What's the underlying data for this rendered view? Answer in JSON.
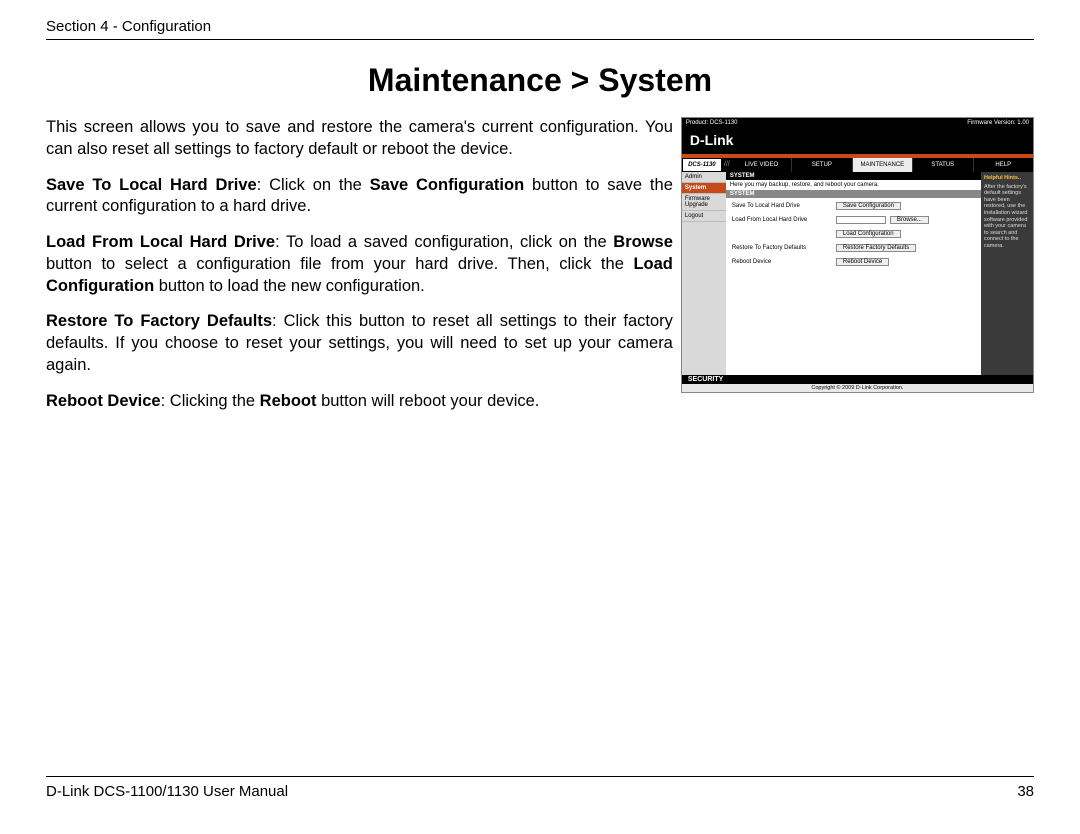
{
  "header": {
    "section": "Section 4 - Configuration"
  },
  "title": "Maintenance > System",
  "intro": "This screen allows you to save and restore the camera's current configuration. You can also reset all settings to factory default or reboot the device.",
  "p1": {
    "lead": "Save To Local Hard Drive",
    "mid1": ": Click on the ",
    "bold": "Save Configuration",
    "rest": " button to save the current configuration to a hard drive."
  },
  "p2": {
    "lead": "Load From Local Hard Drive",
    "mid1": ": To load a saved configuration, click on the ",
    "bold1": "Browse",
    "mid2": " button to select a configuration file from your hard drive.  Then, click the ",
    "bold2": "Load Configuration",
    "rest": " button to load the new configuration."
  },
  "p3": {
    "lead": "Restore To Factory Defaults",
    "rest": ": Click this button to reset all settings to their factory defaults. If you choose to reset your settings, you will need to set up your camera again."
  },
  "p4": {
    "lead": "Reboot Device",
    "mid1": ": Clicking the ",
    "bold": "Reboot",
    "rest": " button will reboot your device."
  },
  "shot": {
    "product": "Product: DCS-1130",
    "fw": "Firmware Version: 1.00",
    "logo": "D-Link",
    "model": "DCS-1130",
    "tabs": [
      "LIVE VIDEO",
      "SETUP",
      "MAINTENANCE",
      "STATUS",
      "HELP"
    ],
    "side": [
      "Admin",
      "System",
      "Firmware Upgrade",
      "Logout"
    ],
    "c_head": "SYSTEM",
    "c_sub": "Here you may backup, restore, and reboot your camera.",
    "c_head2": "SYSTEM",
    "rows": {
      "r1_lbl": "Save To Local Hard Drive",
      "r1_btn": "Save Configuration",
      "r2_lbl": "Load From Local Hard Drive",
      "r2_btn1": "Browse...",
      "r2_btn2": "Load Configuration",
      "r3_lbl": "Restore To Factory Defaults",
      "r3_btn": "Restore Factory Defaults",
      "r4_lbl": "Reboot Device",
      "r4_btn": "Reboot Device"
    },
    "hints_h": "Helpful Hints..",
    "hints": "After the factory's default settings have been restored, use the installation wizard software provided with your camera to search and connect to the camera.",
    "sec": "SECURITY",
    "copy": "Copyright © 2009 D-Link Corporation."
  },
  "footer": {
    "left": "D-Link DCS-1100/1130 User Manual",
    "page": "38"
  }
}
